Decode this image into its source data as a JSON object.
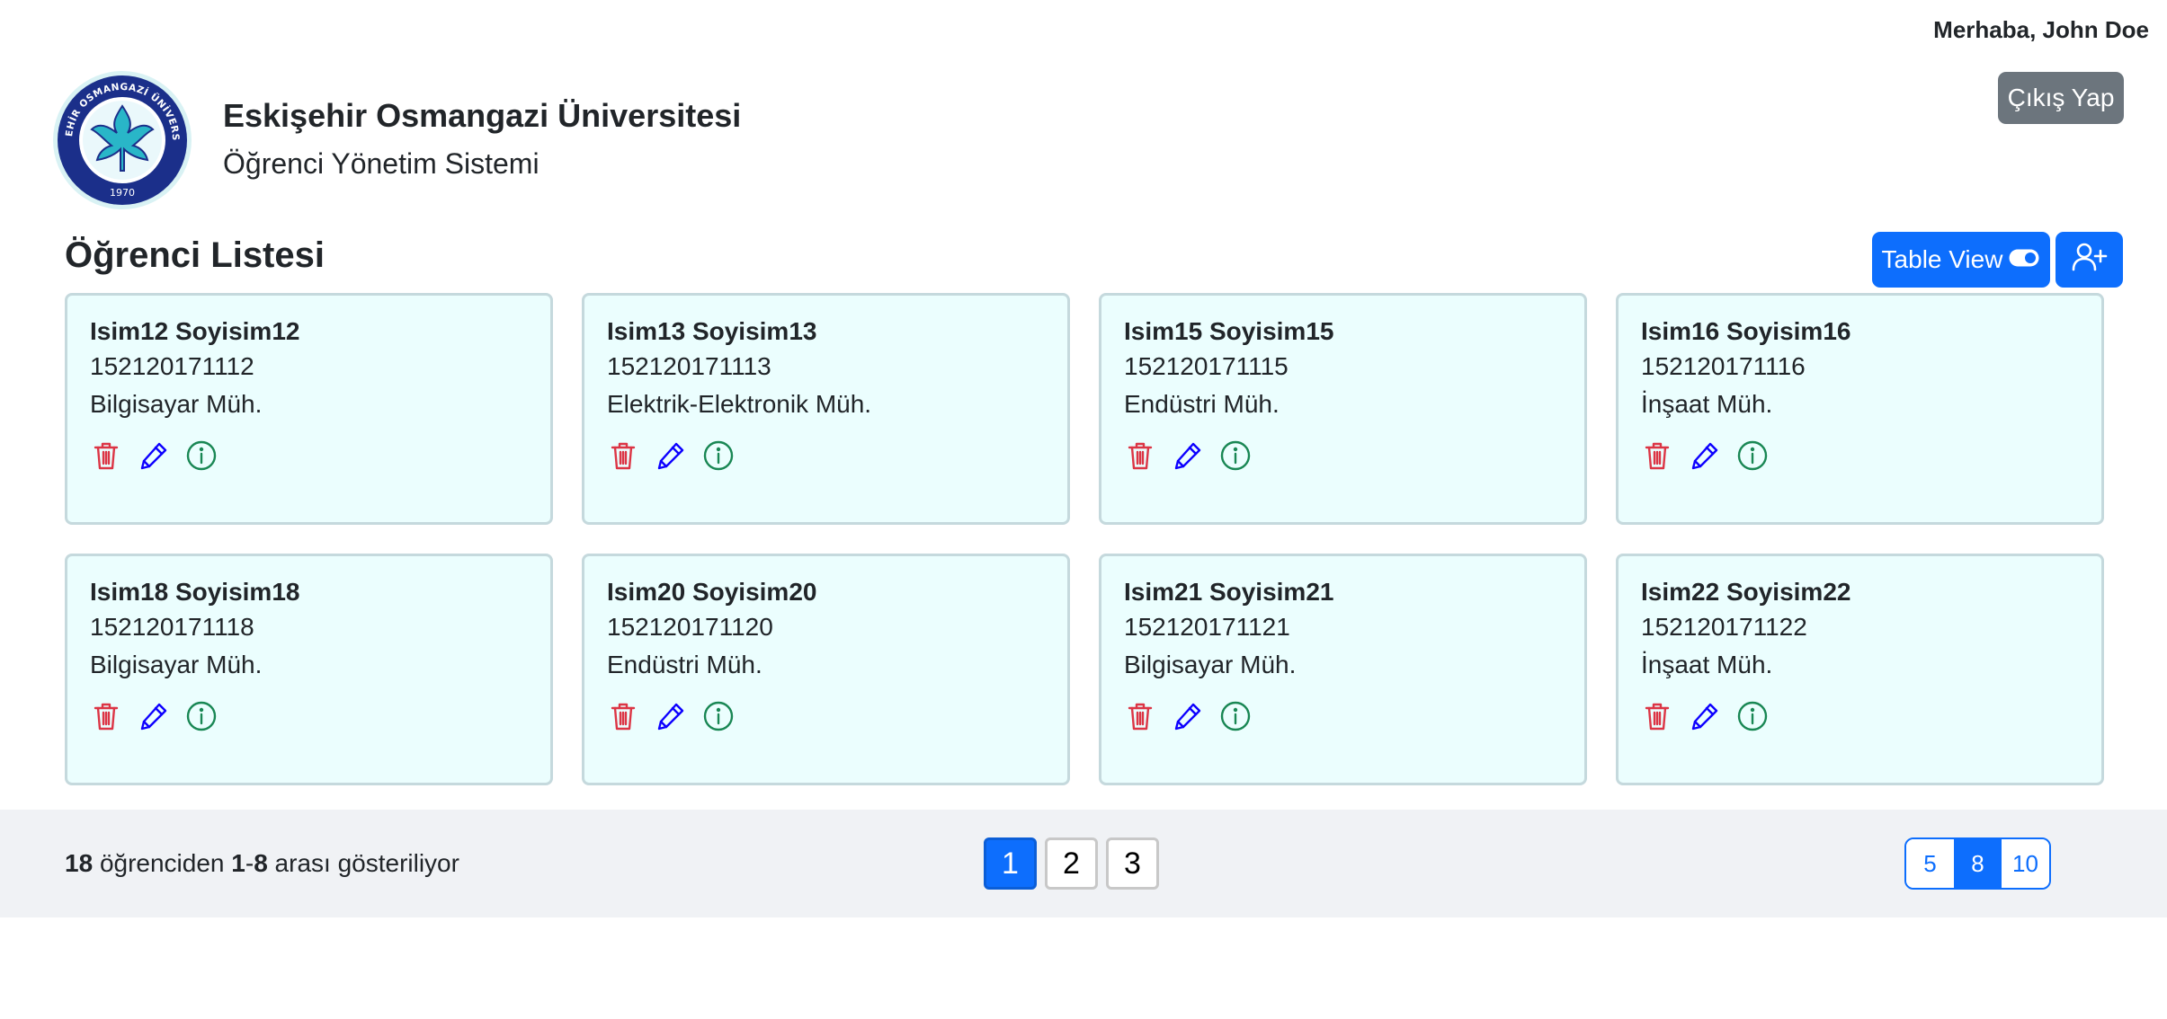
{
  "header": {
    "greeting": "Merhaba, John Doe",
    "logout_label": "Çıkış Yap",
    "university_name": "Eskişehir Osmangazi Üniversitesi",
    "system_name": "Öğrenci Yönetim Sistemi",
    "logo": {
      "ring_text": "ESKİŞEHİR OSMANGAZİ ÜNİVERSİTESİ",
      "year": "1970"
    }
  },
  "list": {
    "title": "Öğrenci Listesi",
    "view_toggle_label": "Table View",
    "view_toggle_icon": "toggle-on-icon",
    "add_icon": "person-plus-icon"
  },
  "students": [
    {
      "name": "Isim12 Soyisim12",
      "number": "152120171112",
      "department": "Bilgisayar Müh."
    },
    {
      "name": "Isim13 Soyisim13",
      "number": "152120171113",
      "department": "Elektrik-Elektronik Müh."
    },
    {
      "name": "Isim15 Soyisim15",
      "number": "152120171115",
      "department": "Endüstri Müh."
    },
    {
      "name": "Isim16 Soyisim16",
      "number": "152120171116",
      "department": "İnşaat Müh."
    },
    {
      "name": "Isim18 Soyisim18",
      "number": "152120171118",
      "department": "Bilgisayar Müh."
    },
    {
      "name": "Isim20 Soyisim20",
      "number": "152120171120",
      "department": "Endüstri Müh."
    },
    {
      "name": "Isim21 Soyisim21",
      "number": "152120171121",
      "department": "Bilgisayar Müh."
    },
    {
      "name": "Isim22 Soyisim22",
      "number": "152120171122",
      "department": "İnşaat Müh."
    }
  ],
  "card_actions": {
    "delete_icon": "trash-icon",
    "edit_icon": "pencil-icon",
    "info_icon": "info-circle-icon",
    "colors": {
      "delete": "#dc3545",
      "edit": "#0d00ff",
      "info": "#198754"
    }
  },
  "footer": {
    "total": "18",
    "summary_mid": "öğrenciden",
    "range_start": "1",
    "range_sep": "-",
    "range_end": "8",
    "summary_end": "arası gösteriliyor",
    "pages": [
      "1",
      "2",
      "3"
    ],
    "active_page": "1",
    "page_sizes": [
      "5",
      "8",
      "10"
    ],
    "active_page_size": "8"
  },
  "colors": {
    "primary": "#0d6efd",
    "secondary": "#6c757d",
    "card_bg": "#ebfefe",
    "card_border": "#c5d9dd",
    "footer_bg": "#f0f2f5"
  }
}
